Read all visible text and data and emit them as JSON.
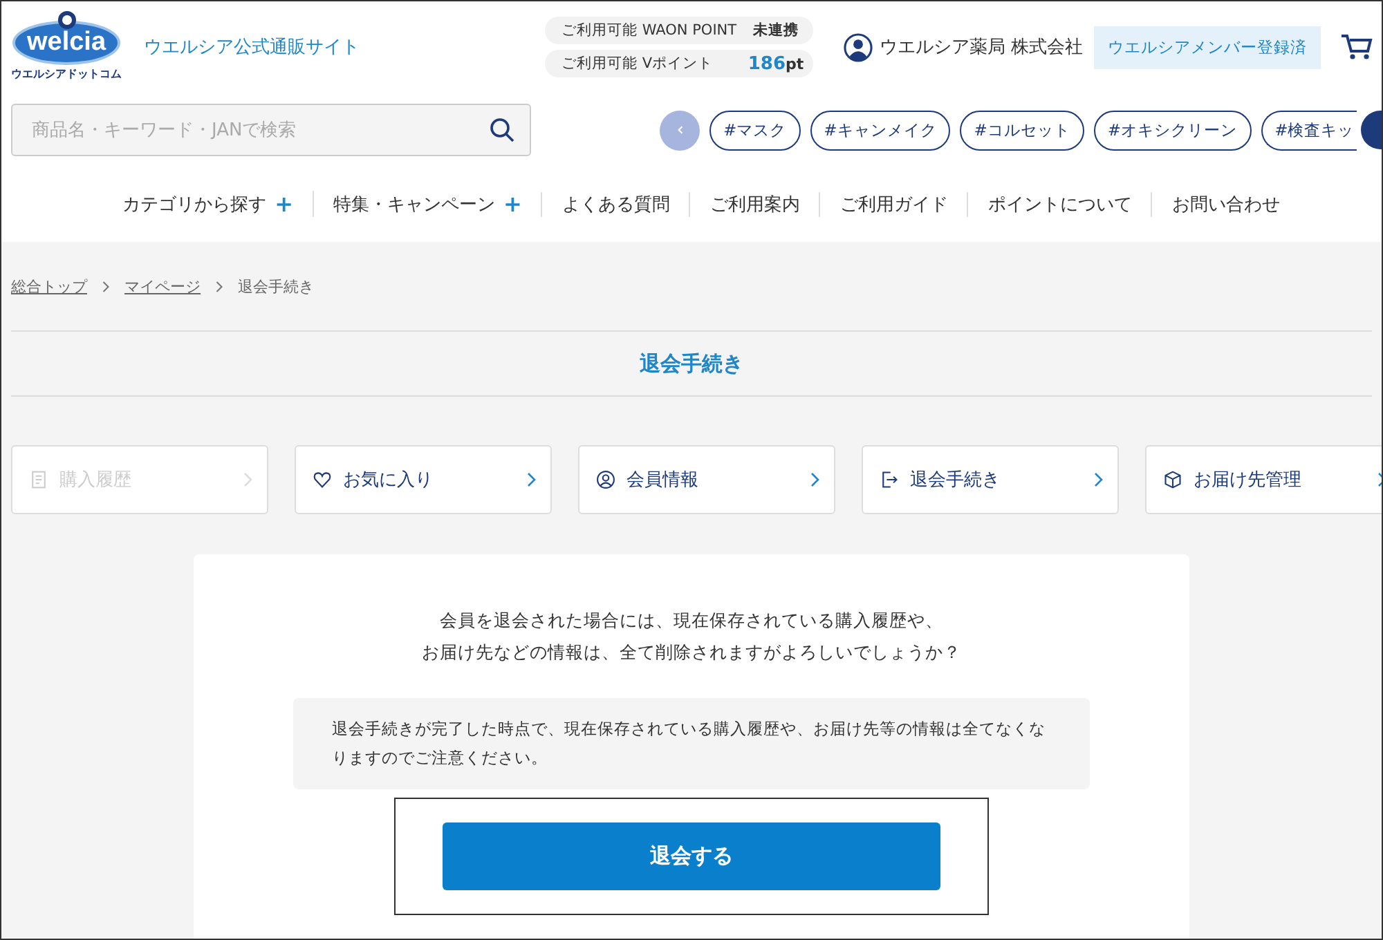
{
  "header": {
    "logo": {
      "wordmark": "welcia",
      "subtitle": "ウエルシアドットコム"
    },
    "site_name": "ウエルシア公式通販サイト",
    "points": [
      {
        "label": "ご利用可能 WAON POINT",
        "value": "未連携"
      },
      {
        "label": "ご利用可能 Vポイント",
        "value": "186",
        "unit": "pt"
      }
    ],
    "user_name": "ウエルシア薬局 株式会社",
    "member_badge": "ウエルシアメンバー登録済"
  },
  "search": {
    "placeholder": "商品名・キーワード・JANで検索"
  },
  "tags": [
    "#マスク",
    "#キャンメイク",
    "#コルセット",
    "#オキシクリーン",
    "#検査キッ"
  ],
  "nav": [
    {
      "label": "カテゴリから探す",
      "icon": "+"
    },
    {
      "label": "特集・キャンペーン",
      "icon": "+"
    },
    {
      "label": "よくある質問"
    },
    {
      "label": "ご利用案内"
    },
    {
      "label": "ご利用ガイド"
    },
    {
      "label": "ポイントについて"
    },
    {
      "label": "お問い合わせ"
    }
  ],
  "breadcrumb": [
    {
      "label": "総合トップ",
      "link": true
    },
    {
      "label": "マイページ",
      "link": true
    },
    {
      "label": "退会手続き",
      "link": false
    }
  ],
  "page_title": "退会手続き",
  "menu": [
    {
      "kind": "history",
      "label": "購入履歴",
      "disabled": true
    },
    {
      "kind": "favorite",
      "label": "お気に入り",
      "disabled": false
    },
    {
      "kind": "member",
      "label": "会員情報",
      "disabled": false
    },
    {
      "kind": "withdraw",
      "label": "退会手続き",
      "disabled": false
    },
    {
      "kind": "delivery",
      "label": "お届け先管理",
      "disabled": false
    }
  ],
  "confirm_text": [
    "会員を退会された場合には、現在保存されている購入履歴や、",
    "お届け先などの情報は、全て削除されますがよろしいでしょうか？"
  ],
  "notice": "退会手続きが完了した時点で、現在保存されている購入履歴や、お届け先等の情報は全てなくなりますのでご注意ください。",
  "submit_button": "退会する"
}
